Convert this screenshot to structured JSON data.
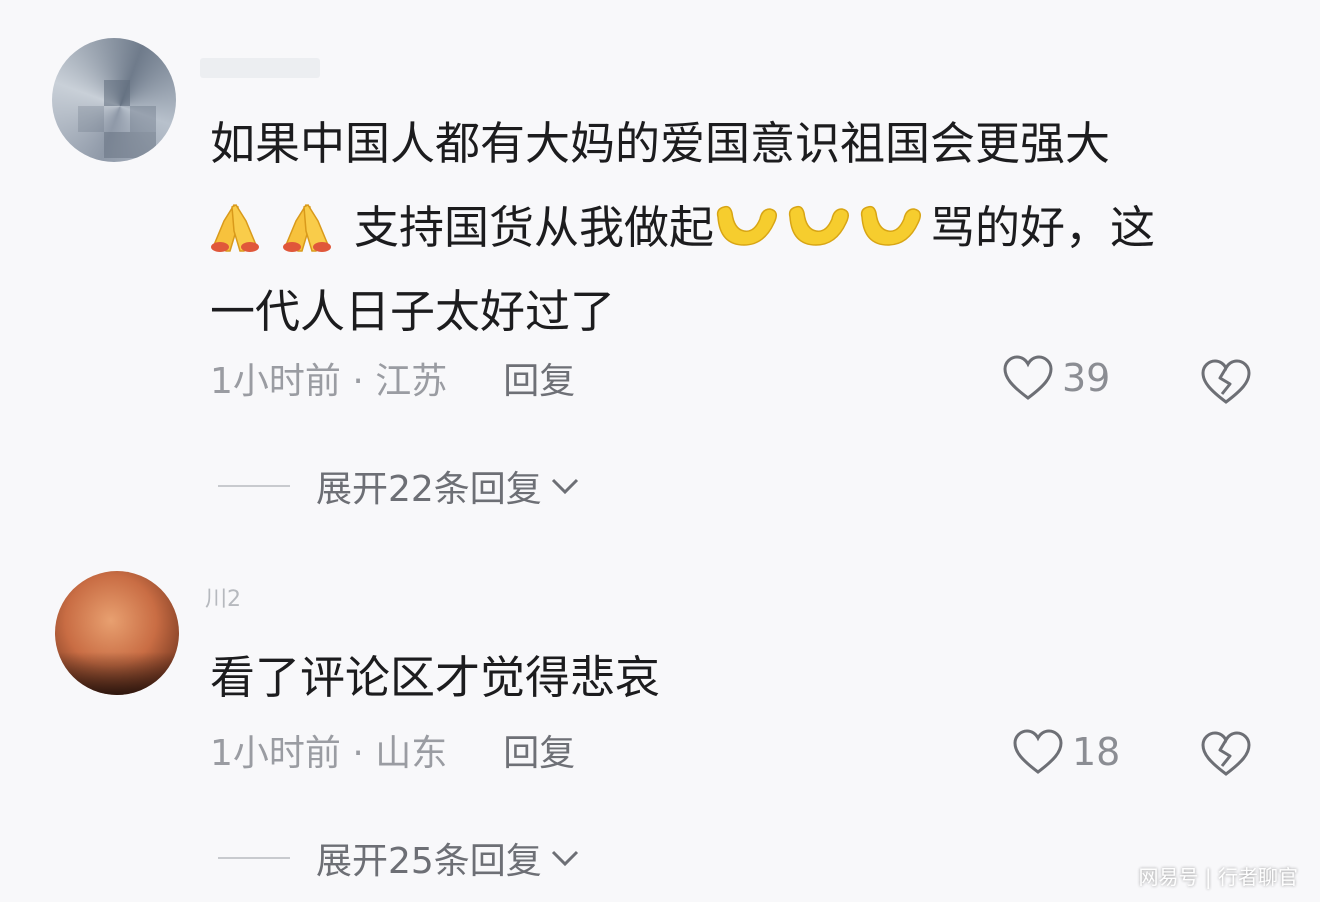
{
  "comments": [
    {
      "username": "",
      "text_line1": "如果中国人都有大妈的爱国意识祖国会更强大",
      "text_line2a": "支持国货从我做起",
      "text_line2b": "骂的好，这",
      "text_line3": "一代人日子太好过了",
      "time_location": "1小时前 · 江苏",
      "reply_label": "回复",
      "like_count": "39",
      "expand_label": "展开22条回复"
    },
    {
      "username": "川2",
      "text_line1": "看了评论区才觉得悲哀",
      "time_location": "1小时前 · 山东",
      "reply_label": "回复",
      "like_count": "18",
      "expand_label": "展开25条回复"
    }
  ],
  "watermark": "网易号 | 行者聊官",
  "icons": {
    "like": "heart-outline-icon",
    "dislike": "broken-heart-icon",
    "expand": "chevron-down-icon",
    "emoji_pray": "folded-hands-emoji",
    "emoji_flex": "flexed-biceps-emoji"
  }
}
